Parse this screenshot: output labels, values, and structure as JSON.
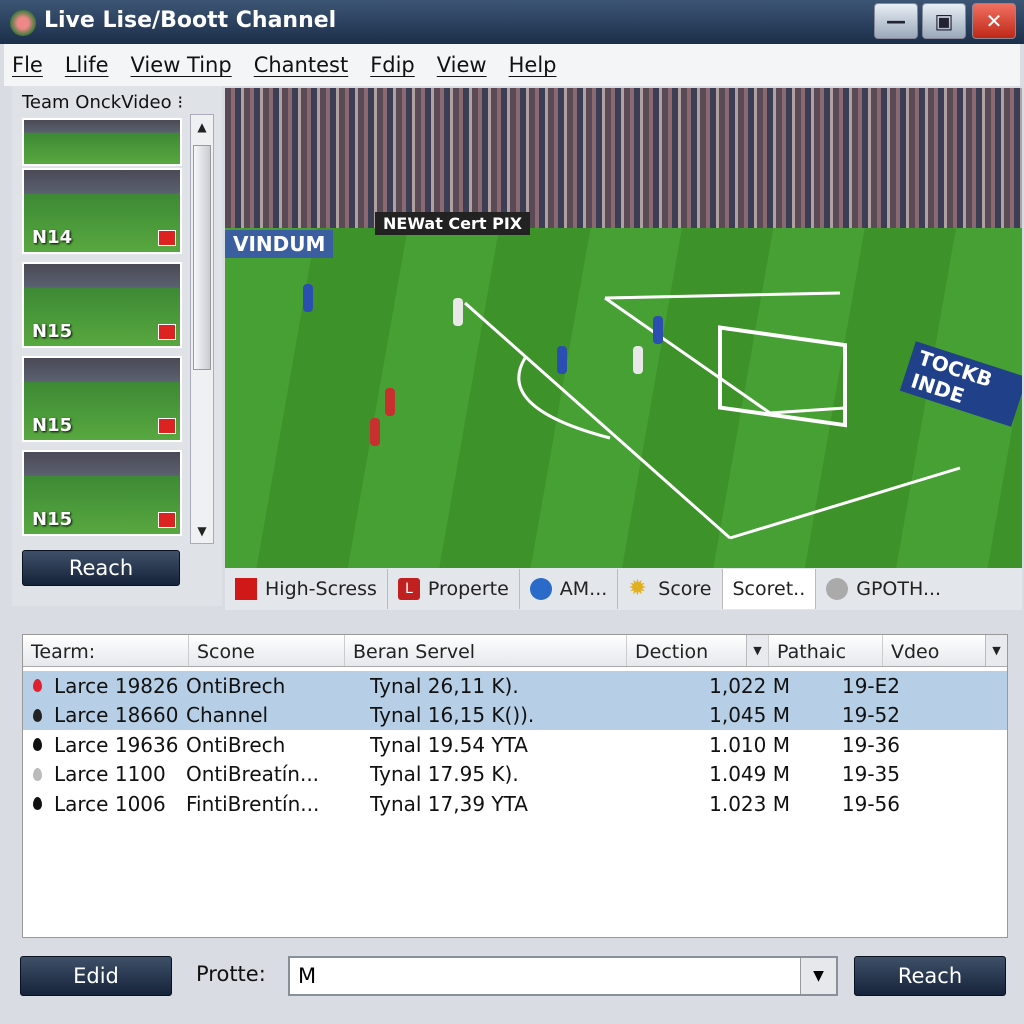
{
  "window": {
    "title": "Live Lise/Boott Channel",
    "minimize": "—",
    "restore": "▣",
    "close": "✕"
  },
  "menu": [
    "Fle",
    "Llife",
    "View Tinp",
    "Chantest",
    "Fdip",
    "View",
    "Help"
  ],
  "left_panel": {
    "title": "Team OnckVideo ⁝",
    "thumbs": [
      "",
      "N14",
      "N15",
      "N15",
      "N15"
    ],
    "button": "Reach"
  },
  "video": {
    "boards": [
      "VINDUM",
      "NEWat Cert PIX",
      "TOCKB INDE"
    ]
  },
  "info_tabs": [
    {
      "label": "High-Scress",
      "icon": "red-square-icon"
    },
    {
      "label": "Properte",
      "icon": "l-badge-icon"
    },
    {
      "label": "AM...",
      "icon": "blue-circle-icon"
    },
    {
      "label": "Score",
      "icon": "sun-icon"
    },
    {
      "label": "Scoret..",
      "icon": "",
      "active": true
    },
    {
      "label": "GPOTH...",
      "icon": "grey-circle-icon"
    }
  ],
  "table": {
    "columns": [
      "Tearm:",
      "Scone",
      "Beran Servel",
      "Dection",
      "Pathaic",
      "Vdeo"
    ],
    "rows": [
      {
        "team": "Larce 19826",
        "scone": "OntiBrech",
        "server": "Tynal 26,11 K).",
        "dection": "1,022 M",
        "pathaic": "19-E2",
        "pin": "#e02030",
        "selected": true
      },
      {
        "team": "Larce 18660",
        "scone": "Channel",
        "server": "Tynal 16,15 K()).",
        "dection": "1,045 M",
        "pathaic": "19-52",
        "pin": "#222",
        "selected": true
      },
      {
        "team": "Larce 19636",
        "scone": "OntiBrech",
        "server": "Tynal 19.54 YTA",
        "dection": "1.010 M",
        "pathaic": "19-36",
        "pin": "#111",
        "selected": false
      },
      {
        "team": "Larce 1100",
        "scone": "OntiBreatín...",
        "server": "Tynal 17.95 K).",
        "dection": "1.049 M",
        "pathaic": "19-35",
        "pin": "#bbb",
        "selected": false
      },
      {
        "team": "Larce 1006",
        "scone": "FintiBrentín...",
        "server": "Tynal 17,39 YTA",
        "dection": "1.023 M",
        "pathaic": "19-56",
        "pin": "#111",
        "selected": false
      }
    ]
  },
  "footer": {
    "edit_button": "Edid",
    "label": "Protte:",
    "combo_value": "M",
    "reach_button": "Reach"
  },
  "colors": {
    "selected_row": "#b7cfe6",
    "title_bar": "#1c2f4a"
  }
}
